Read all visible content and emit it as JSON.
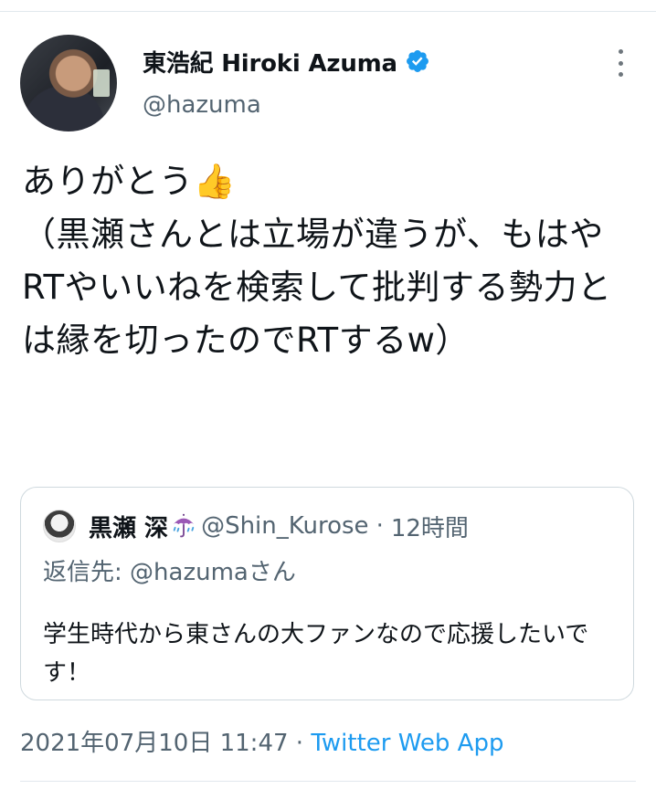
{
  "author": {
    "display_name": "東浩紀 Hiroki Azuma",
    "handle": "@hazuma",
    "verified_icon": "verified-badge-icon",
    "verified_color": "#1d9bf0"
  },
  "more_icon": "three-dots-vertical-icon",
  "tweet": {
    "text": "ありがとう👍\n（黒瀬さんとは立場が違うが、もはやRTやいいねを検索して批判する勢力とは縁を切ったのでRTするw）"
  },
  "quote": {
    "display_name": "黒瀬 深",
    "name_emoji_icon": "umbrella-rain-icon",
    "handle": "@Shin_Kurose",
    "separator": "·",
    "time": "12時間",
    "reply_prefix": "返信先: ",
    "reply_to": "@hazumaさん",
    "text": "学生時代から東さんの大ファンなので応援したいです！"
  },
  "meta": {
    "timestamp": "2021年07月10日 11:47",
    "separator": " · ",
    "app": "Twitter Web App"
  },
  "colors": {
    "text_primary": "#0f1419",
    "text_secondary": "#536471",
    "link": "#1d9bf0",
    "border": "#cfd9de"
  }
}
